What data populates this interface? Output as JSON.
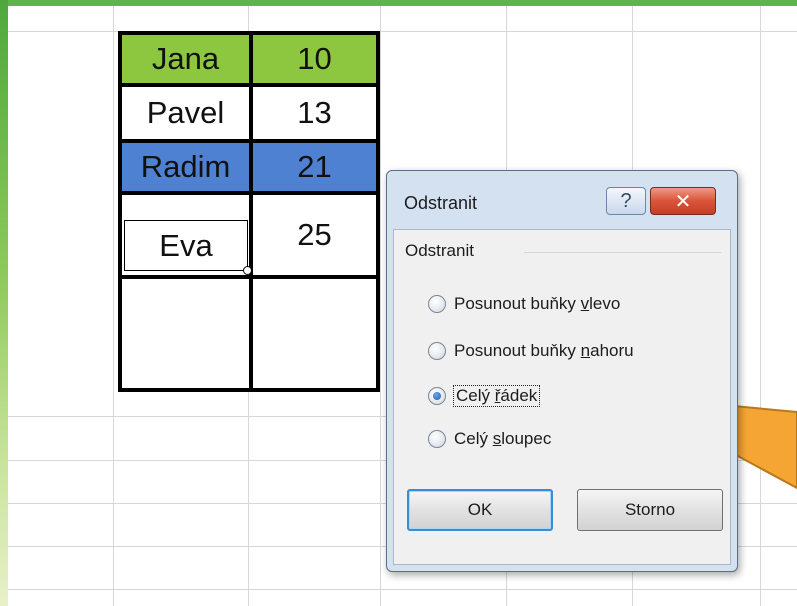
{
  "table": {
    "rows": [
      {
        "name": "Jana",
        "value": "10",
        "bg": "#8dc63f"
      },
      {
        "name": "Pavel",
        "value": "13",
        "bg": "#ffffff"
      },
      {
        "name": "Radim",
        "value": "21",
        "bg": "#4f81d3"
      },
      {
        "name": "Eva",
        "value": "25",
        "bg": "#ffffff"
      },
      {
        "name": "",
        "value": "",
        "bg": "#ffffff"
      }
    ]
  },
  "dialog": {
    "title": "Odstranit",
    "help_icon": "?",
    "close_icon": "✕",
    "group_label": "Odstranit",
    "options": [
      {
        "pre": "Posunout buňky ",
        "key": "v",
        "post": "levo",
        "checked": false
      },
      {
        "pre": "Posunout buňky ",
        "key": "n",
        "post": "ahoru",
        "checked": false
      },
      {
        "pre": "Celý ",
        "key": "ř",
        "post": "ádek",
        "checked": true
      },
      {
        "pre": "Celý ",
        "key": "s",
        "post": "loupec",
        "checked": false
      }
    ],
    "ok_label": "OK",
    "cancel_label": "Storno"
  },
  "colors": {
    "accent_green": "#5cb54a",
    "callout_orange": "#f5a533",
    "selected_row_blue": "#4f81d3",
    "header_green": "#8dc63f"
  }
}
